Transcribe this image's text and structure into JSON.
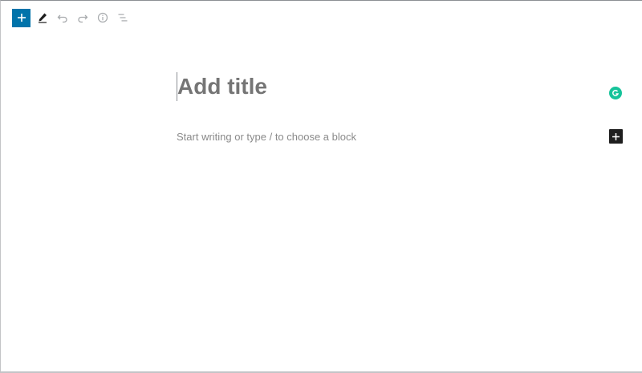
{
  "toolbar": {
    "items": [
      {
        "icon": "plus-icon",
        "color": "#0073aa"
      },
      {
        "icon": "pencil-icon"
      },
      {
        "icon": "undo-icon"
      },
      {
        "icon": "redo-icon"
      },
      {
        "icon": "info-icon"
      },
      {
        "icon": "list-view-icon"
      }
    ]
  },
  "editor": {
    "title_placeholder": "Add title",
    "body_placeholder": "Start writing or type / to choose a block"
  },
  "colors": {
    "accent": "#0073aa",
    "grammarly": "#15c39a",
    "inserter": "#1e1e1e"
  }
}
